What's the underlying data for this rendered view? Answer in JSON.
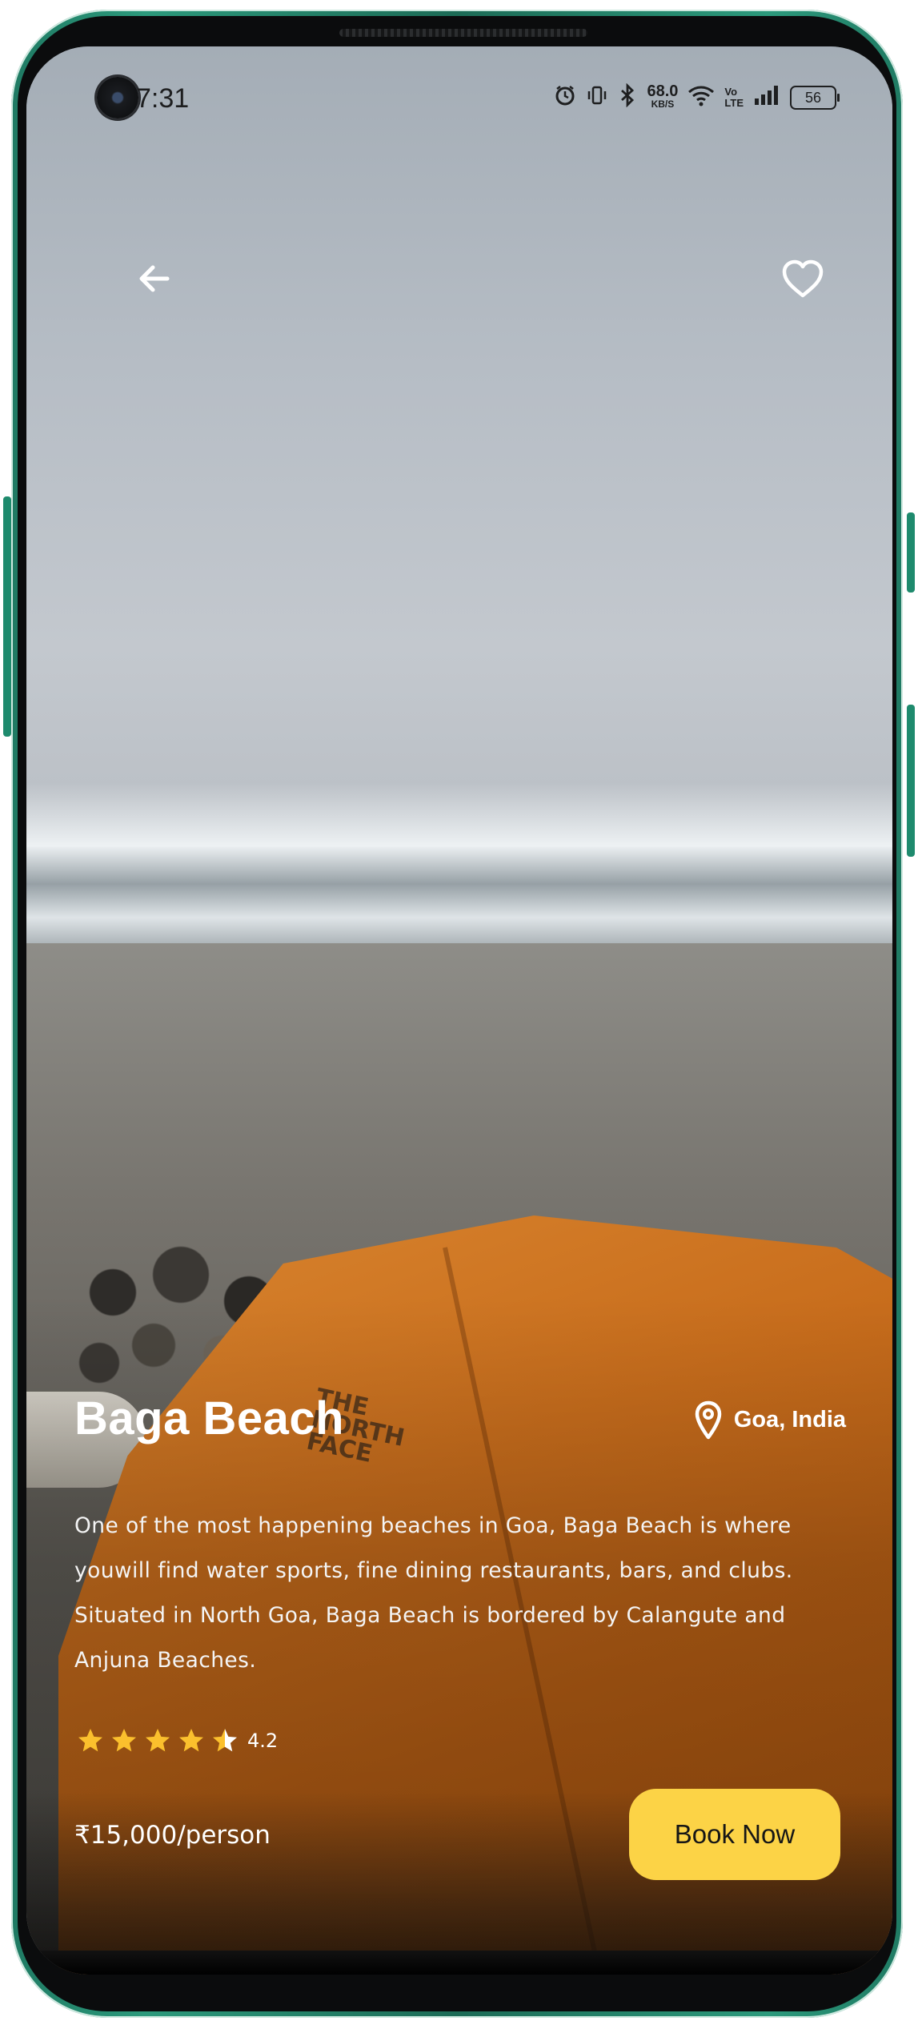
{
  "status_bar": {
    "time": "7:31",
    "net_speed_value": "68.0",
    "net_speed_unit": "KB/S",
    "volte_top": "Vo",
    "volte_bottom": "LTE",
    "battery": "56",
    "icons": [
      "alarm-icon",
      "vibrate-icon",
      "bluetooth-icon",
      "wifi-icon",
      "signal-icon",
      "battery-icon"
    ]
  },
  "header": {
    "back_icon": "arrow-left-icon",
    "favorite_icon": "heart-outline-icon"
  },
  "place": {
    "name": "Baga Beach",
    "location": "Goa, India",
    "location_icon": "map-pin-icon",
    "description": "One of the most happening beaches in Goa, Baga Beach is where youwill find water sports, fine dining restaurants, bars, and clubs. Situated in North Goa, Baga Beach is bordered by Calangute and Anjuna Beaches.",
    "rating": 4.2,
    "rating_label": "4.2",
    "max_rating": 5
  },
  "footer": {
    "price": "₹15,000/person",
    "book_label": "Book Now"
  },
  "colors": {
    "accent": "#fcd346",
    "star": "#fbc02d",
    "text": "#ffffff"
  }
}
